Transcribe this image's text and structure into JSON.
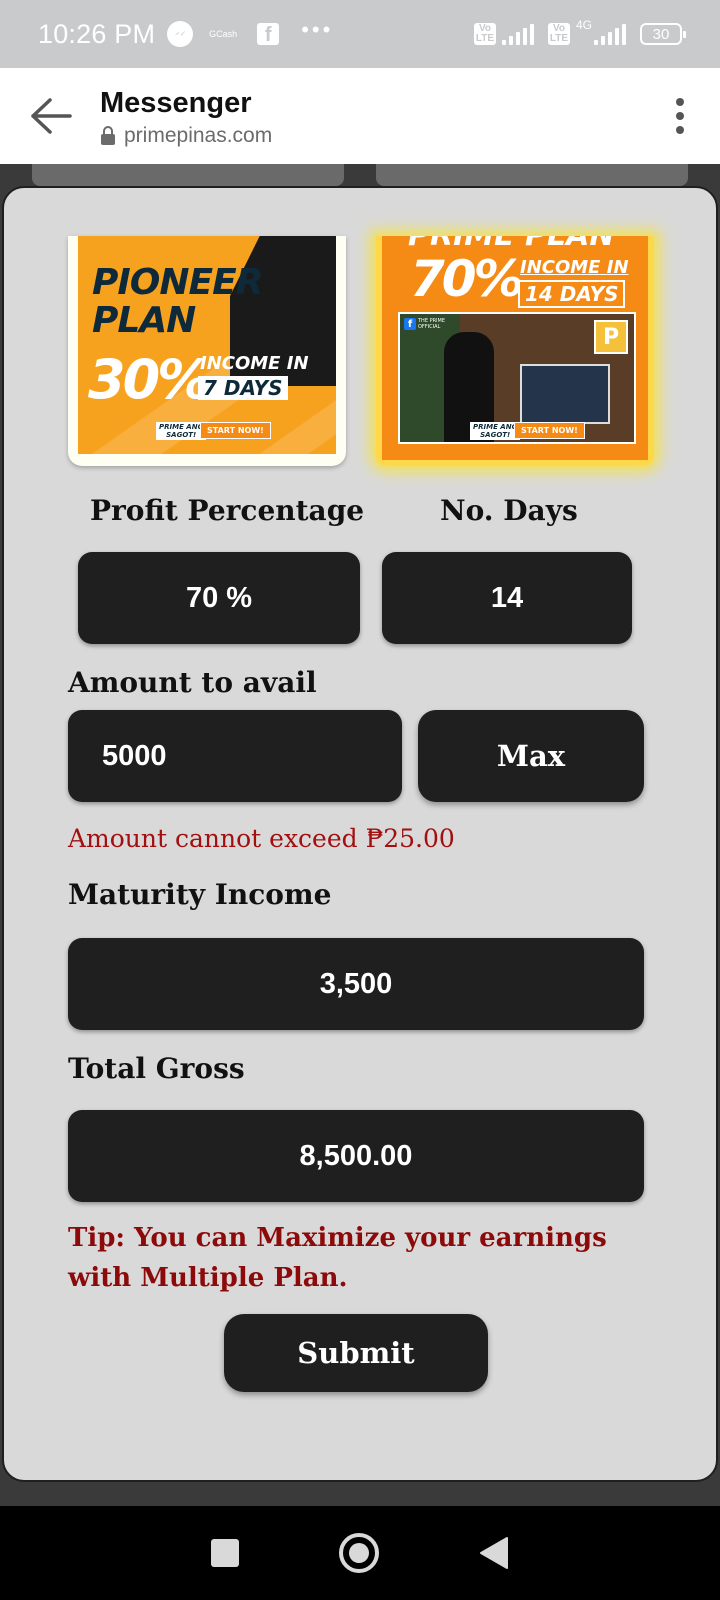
{
  "status_bar": {
    "time": "10:26 PM",
    "gcash_label": "GCash",
    "network_label": "4G",
    "net_tag_1": "Vo LTE",
    "net_tag_2": "Vo LTE",
    "battery": "30"
  },
  "app_bar": {
    "title": "Messenger",
    "url": "primepinas.com",
    "back_icon": "arrow-left-icon",
    "menu_icon": "more-vertical-icon"
  },
  "plans": [
    {
      "name_line1": "PIONEER",
      "name_line2": "PLAN",
      "percent": "30%",
      "income_line1": "INCOME IN",
      "days": "7 DAYS",
      "tag_line1": "PRIME ANG",
      "tag_line2": "SAGOT!",
      "start": "START NOW!"
    },
    {
      "top_text": "PRIME PLAN",
      "percent": "70%",
      "income_line1": "INCOME IN",
      "days": "14 DAYS",
      "fb_line1": "THE PRIME",
      "fb_line2": "OFFICIAL",
      "tag_line1": "PRIME ANG",
      "tag_line2": "SAGOT!",
      "start": "START NOW!"
    }
  ],
  "form": {
    "profit_label": "Profit Percentage",
    "days_label": "No. Days",
    "profit_value": "70 %",
    "days_value": "14",
    "amount_label": "Amount to avail",
    "amount_value": "5000",
    "max_label": "Max",
    "error_text": "Amount cannot exceed ₱25.00",
    "maturity_label": "Maturity Income",
    "maturity_value": "3,500",
    "gross_label": "Total Gross",
    "gross_value": "8,500.00",
    "tip_text": "Tip: You can Maximize your earnings with Multiple Plan.",
    "submit_label": "Submit"
  },
  "colors": {
    "field_bg": "#1f1f1f",
    "modal_bg": "#d9d9d9",
    "error": "#a30f0f",
    "plan_orange": "#f7a21e"
  }
}
